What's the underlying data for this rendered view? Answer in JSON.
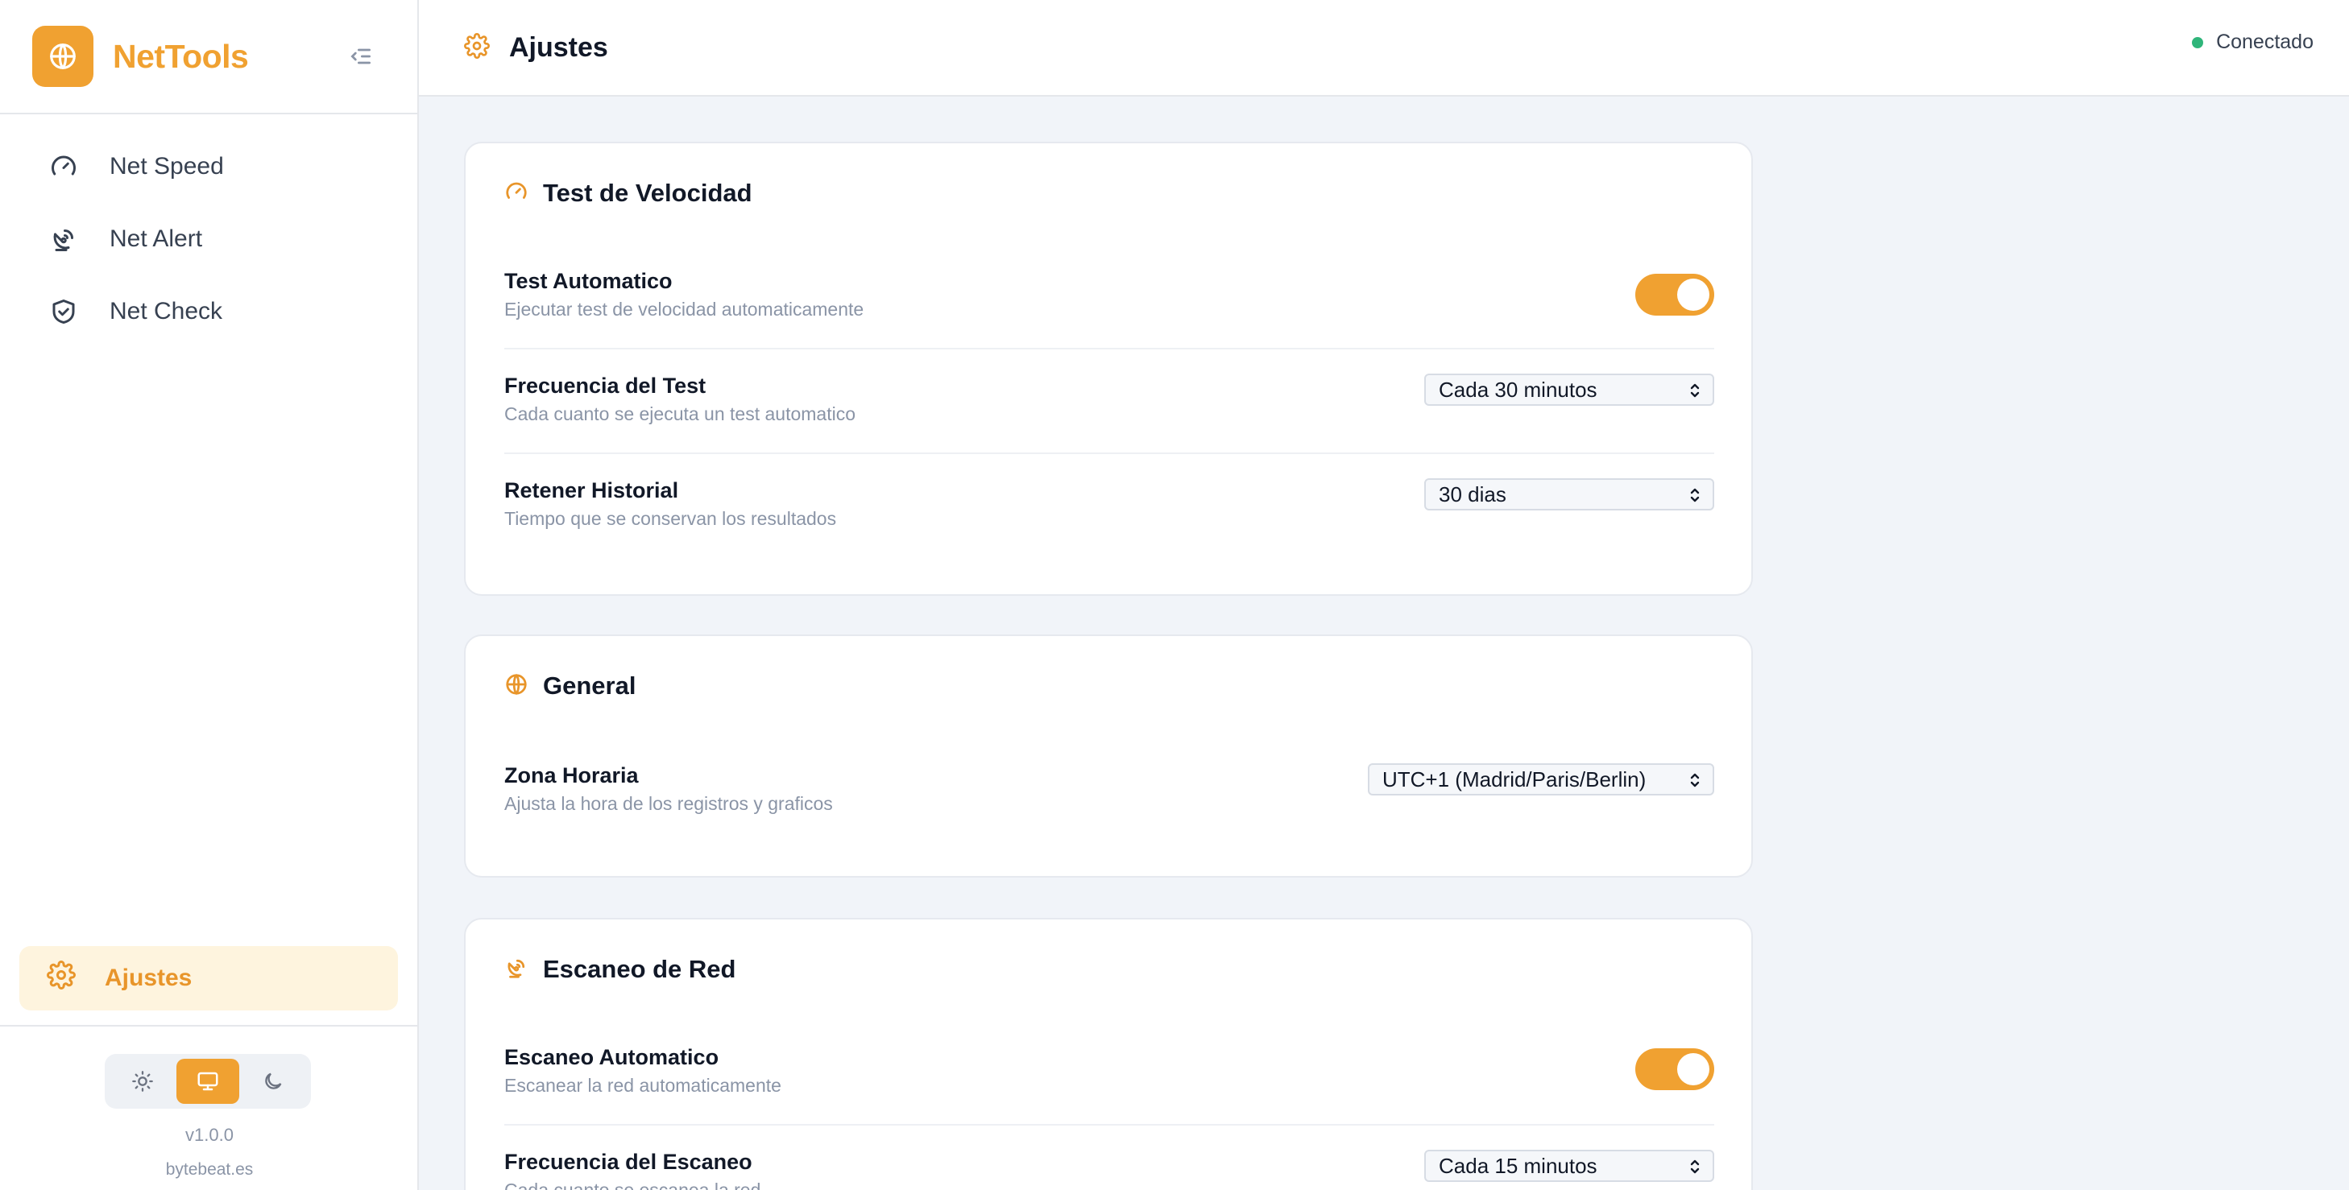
{
  "app": {
    "name": "NetTools"
  },
  "sidebar": {
    "items": [
      {
        "label": "Net Speed",
        "icon": "gauge-icon"
      },
      {
        "label": "Net Alert",
        "icon": "radar-icon"
      },
      {
        "label": "Net Check",
        "icon": "shield-check-icon"
      }
    ],
    "settings_label": "Ajustes",
    "version": "v1.0.0",
    "credit": "bytebeat.es",
    "theme_active": "system"
  },
  "header": {
    "title": "Ajustes",
    "status": "Conectado",
    "status_color": "#2fb57a"
  },
  "accent_color": "#f0a131",
  "sections": {
    "speed": {
      "title": "Test de Velocidad",
      "auto": {
        "title": "Test Automatico",
        "desc": "Ejecutar test de velocidad automaticamente",
        "enabled": true
      },
      "freq": {
        "title": "Frecuencia del Test",
        "desc": "Cada cuanto se ejecuta un test automatico",
        "value": "Cada 30 minutos"
      },
      "history": {
        "title": "Retener Historial",
        "desc": "Tiempo que se conservan los resultados",
        "value": "30 dias"
      }
    },
    "general": {
      "title": "General",
      "tz": {
        "title": "Zona Horaria",
        "desc": "Ajusta la hora de los registros y graficos",
        "value": "UTC+1 (Madrid/Paris/Berlin)"
      }
    },
    "scan": {
      "title": "Escaneo de Red",
      "auto": {
        "title": "Escaneo Automatico",
        "desc": "Escanear la red automaticamente",
        "enabled": true
      },
      "freq": {
        "title": "Frecuencia del Escaneo",
        "desc": "Cada cuanto se escanea la red",
        "value": "Cada 15 minutos"
      }
    }
  }
}
